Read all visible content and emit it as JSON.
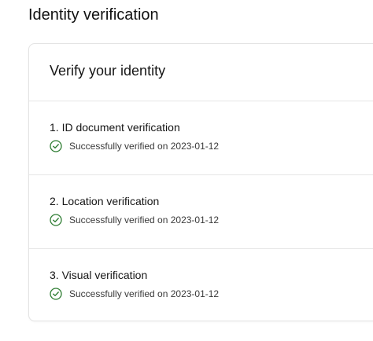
{
  "page": {
    "title": "Identity verification"
  },
  "card": {
    "title": "Verify your identity",
    "steps": [
      {
        "label": "1. ID document verification",
        "status": "Successfully verified on 2023-01-12",
        "icon": "check-circle-icon"
      },
      {
        "label": "2. Location verification",
        "status": "Successfully verified on 2023-01-12",
        "icon": "check-circle-icon"
      },
      {
        "label": "3. Visual verification",
        "status": "Successfully verified on 2023-01-12",
        "icon": "check-circle-icon"
      }
    ]
  },
  "colors": {
    "success": "#2e7d32",
    "border": "#e6e6e6"
  }
}
